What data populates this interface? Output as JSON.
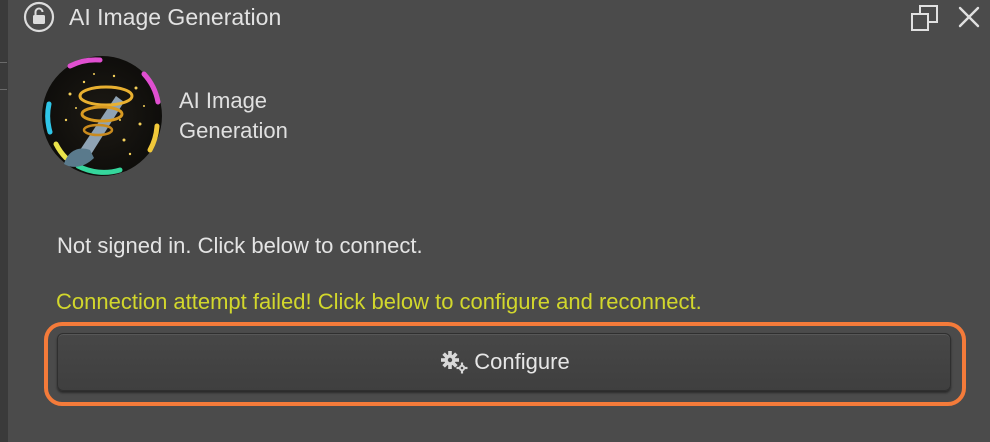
{
  "window": {
    "title": "AI Image Generation"
  },
  "header": {
    "plugin_name_line1": "AI Image",
    "plugin_name_line2": "Generation"
  },
  "main": {
    "status_text": "Not signed in. Click below to connect.",
    "error_text": "Connection attempt failed! Click below to configure and reconnect.",
    "configure_label": "Configure"
  },
  "icons": {
    "lock": "lock-icon",
    "float": "float-window-icon",
    "close": "close-icon",
    "gear": "gear-icon",
    "logo": "plugin-logo"
  },
  "colors": {
    "error_text": "#d2d72c",
    "highlight_ring": "#f47b3a",
    "panel_bg": "#4b4b4b"
  }
}
